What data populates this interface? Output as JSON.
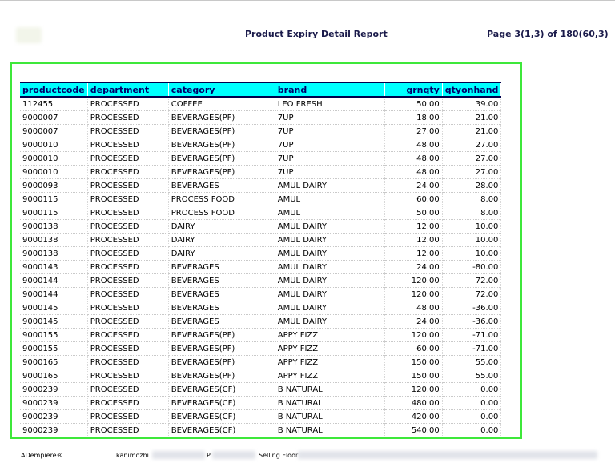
{
  "header": {
    "title": "Product Expiry Detail Report",
    "page_info": "Page 3(1,3) of 180(60,3)"
  },
  "table": {
    "columns": [
      "productcode",
      "department",
      "category",
      "brand",
      "grnqty",
      "qtyonhand"
    ],
    "rows": [
      [
        "112455",
        "PROCESSED",
        "COFFEE",
        "LEO FRESH",
        "50.00",
        "39.00"
      ],
      [
        "9000007",
        "PROCESSED",
        "BEVERAGES(PF)",
        "7UP",
        "18.00",
        "21.00"
      ],
      [
        "9000007",
        "PROCESSED",
        "BEVERAGES(PF)",
        "7UP",
        "27.00",
        "21.00"
      ],
      [
        "9000010",
        "PROCESSED",
        "BEVERAGES(PF)",
        "7UP",
        "48.00",
        "27.00"
      ],
      [
        "9000010",
        "PROCESSED",
        "BEVERAGES(PF)",
        "7UP",
        "48.00",
        "27.00"
      ],
      [
        "9000010",
        "PROCESSED",
        "BEVERAGES(PF)",
        "7UP",
        "48.00",
        "27.00"
      ],
      [
        "9000093",
        "PROCESSED",
        "BEVERAGES",
        "AMUL DAIRY",
        "24.00",
        "28.00"
      ],
      [
        "9000115",
        "PROCESSED",
        "PROCESS FOOD",
        "AMUL",
        "60.00",
        "8.00"
      ],
      [
        "9000115",
        "PROCESSED",
        "PROCESS FOOD",
        "AMUL",
        "50.00",
        "8.00"
      ],
      [
        "9000138",
        "PROCESSED",
        "DAIRY",
        "AMUL DAIRY",
        "12.00",
        "10.00"
      ],
      [
        "9000138",
        "PROCESSED",
        "DAIRY",
        "AMUL DAIRY",
        "12.00",
        "10.00"
      ],
      [
        "9000138",
        "PROCESSED",
        "DAIRY",
        "AMUL DAIRY",
        "12.00",
        "10.00"
      ],
      [
        "9000143",
        "PROCESSED",
        "BEVERAGES",
        "AMUL DAIRY",
        "24.00",
        "-80.00"
      ],
      [
        "9000144",
        "PROCESSED",
        "BEVERAGES",
        "AMUL DAIRY",
        "120.00",
        "72.00"
      ],
      [
        "9000144",
        "PROCESSED",
        "BEVERAGES",
        "AMUL DAIRY",
        "120.00",
        "72.00"
      ],
      [
        "9000145",
        "PROCESSED",
        "BEVERAGES",
        "AMUL DAIRY",
        "48.00",
        "-36.00"
      ],
      [
        "9000145",
        "PROCESSED",
        "BEVERAGES",
        "AMUL DAIRY",
        "24.00",
        "-36.00"
      ],
      [
        "9000155",
        "PROCESSED",
        "BEVERAGES(PF)",
        "APPY FIZZ",
        "120.00",
        "-71.00"
      ],
      [
        "9000155",
        "PROCESSED",
        "BEVERAGES(PF)",
        "APPY FIZZ",
        "60.00",
        "-71.00"
      ],
      [
        "9000165",
        "PROCESSED",
        "BEVERAGES(PF)",
        "APPY FIZZ",
        "150.00",
        "55.00"
      ],
      [
        "9000165",
        "PROCESSED",
        "BEVERAGES(PF)",
        "APPY FIZZ",
        "150.00",
        "55.00"
      ],
      [
        "9000239",
        "PROCESSED",
        "BEVERAGES(CF)",
        "B NATURAL",
        "120.00",
        "0.00"
      ],
      [
        "9000239",
        "PROCESSED",
        "BEVERAGES(CF)",
        "B NATURAL",
        "480.00",
        "0.00"
      ],
      [
        "9000239",
        "PROCESSED",
        "BEVERAGES(CF)",
        "B NATURAL",
        "420.00",
        "0.00"
      ],
      [
        "9000239",
        "PROCESSED",
        "BEVERAGES(CF)",
        "B NATURAL",
        "540.00",
        "0.00"
      ]
    ]
  },
  "footer": {
    "app": "ADempiere®",
    "user": "kanimozhi",
    "separator": "P",
    "location": "Selling Floor"
  },
  "colors": {
    "header_bg": "#00ffff",
    "header_text": "#00006a",
    "highlight_frame": "#3ee83a"
  }
}
